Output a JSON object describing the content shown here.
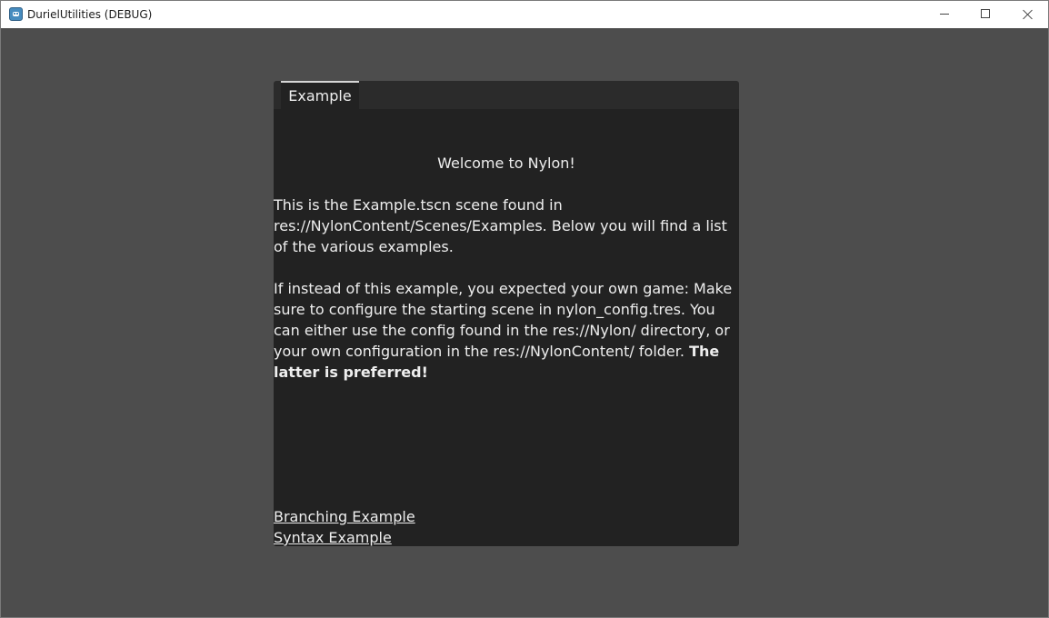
{
  "window": {
    "title": "DurielUtilities (DEBUG)",
    "icon": "godot-icon",
    "controls": [
      "minimize-icon",
      "maximize-icon",
      "close-icon"
    ]
  },
  "tabs": [
    {
      "label": "Example",
      "active": true
    }
  ],
  "content": {
    "welcome": "Welcome to Nylon!",
    "intro": "This is the Example.tscn scene found in res://NylonContent/Scenes/Examples. Below you will find a list of the various examples.",
    "instructions": "If instead of this example, you expected your own game: Make sure to configure the starting scene in nylon_config.tres. You can either use the config found in the res://Nylon/ directory, or your own configuration in the res://NylonContent/ folder.",
    "instructions_emphasis": "The latter is preferred!"
  },
  "links": [
    {
      "label": "Branching Example"
    },
    {
      "label": "Syntax Example"
    }
  ],
  "colors": {
    "background": "#4d4d4d",
    "panel": "#222222",
    "tabbar": "#2b2b2b",
    "text": "#eeeeee",
    "titlebar": "#ffffff"
  }
}
